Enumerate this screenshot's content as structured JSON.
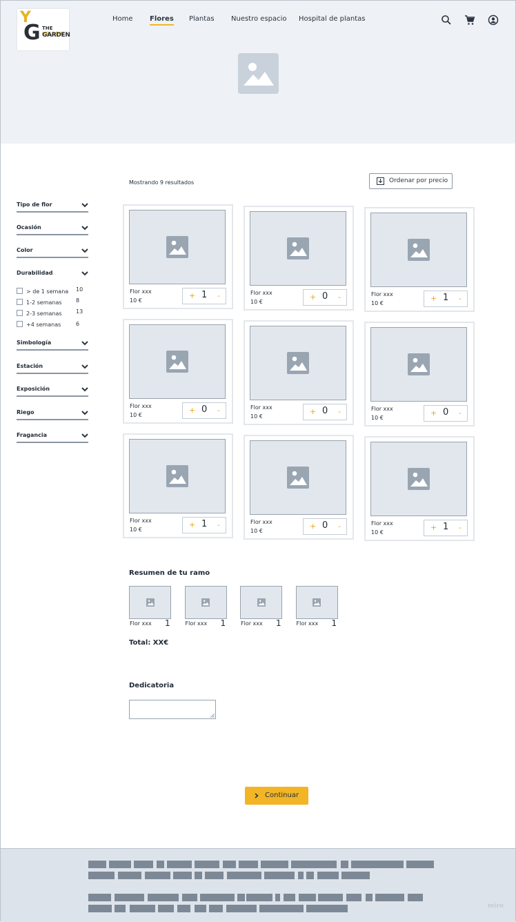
{
  "brand": {
    "mark_y": "Y",
    "mark_g": "G",
    "line1_a": "THE ",
    "line1_b": "YELLOW",
    "line2": "GARDEN",
    "accent": "#f0b824"
  },
  "nav": {
    "items": [
      "Home",
      "Flores",
      "Plantas",
      "Nuestro espacio",
      "Hospital de plantas"
    ],
    "active": "Flores"
  },
  "header_icons": [
    "search-icon",
    "cart-icon",
    "user-icon"
  ],
  "results": {
    "text": "Mostrando 9 resultados",
    "sort_label": "Ordenar por precio"
  },
  "filters": [
    {
      "label": "Tipo de flor"
    },
    {
      "label": "Ocasión"
    },
    {
      "label": "Color"
    },
    {
      "label": "Durabilidad",
      "options": [
        {
          "label": "> de 1 semana",
          "count": "10"
        },
        {
          "label": "1-2 semanas",
          "count": "8"
        },
        {
          "label": "2-3 semanas",
          "count": "13"
        },
        {
          "label": "+4 semanas",
          "count": "6"
        }
      ]
    },
    {
      "label": "Simbología"
    },
    {
      "label": "Estación"
    },
    {
      "label": "Exposición"
    },
    {
      "label": "Riego"
    },
    {
      "label": "Fragancia"
    }
  ],
  "products": [
    {
      "name": "Flor xxx",
      "price": "10 €",
      "qty": "1"
    },
    {
      "name": "Flor xxx",
      "price": "10 €",
      "qty": "0"
    },
    {
      "name": "Flor xxx",
      "price": "10 €",
      "qty": "1"
    },
    {
      "name": "Flor xxx",
      "price": "10 €",
      "qty": "0"
    },
    {
      "name": "Flor xxx",
      "price": "10 €",
      "qty": "0"
    },
    {
      "name": "Flor xxx",
      "price": "10 €",
      "qty": "0"
    },
    {
      "name": "Flor xxx",
      "price": "10 €",
      "qty": "1"
    },
    {
      "name": "Flor xxx",
      "price": "10 €",
      "qty": "0"
    },
    {
      "name": "Flor xxx",
      "price": "10 €",
      "qty": "1"
    }
  ],
  "stepper": {
    "plus": "+",
    "minus": "-"
  },
  "summary": {
    "title": "Resumen de tu ramo",
    "items": [
      {
        "name": "Flor xxx",
        "qty": "1"
      },
      {
        "name": "Flor xxx",
        "qty": "1"
      },
      {
        "name": "Flor xxx",
        "qty": "1"
      },
      {
        "name": "Flor xxx",
        "qty": "1"
      }
    ],
    "total": "Total: XX€"
  },
  "dedication": {
    "title": "Dedicatoria",
    "value": ""
  },
  "cta": {
    "label": "Continuar"
  },
  "watermark": "miro"
}
